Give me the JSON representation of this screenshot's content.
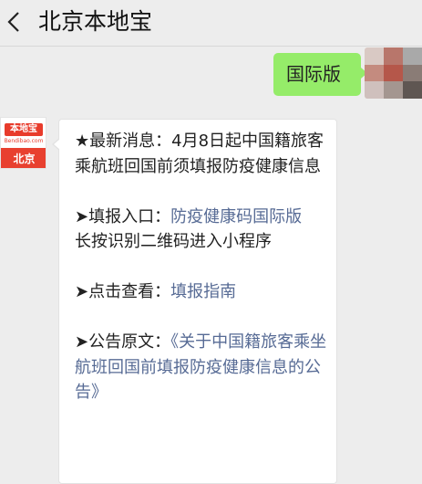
{
  "header": {
    "title": "北京本地宝"
  },
  "my_message": {
    "text": "国际版"
  },
  "avatar_right": {
    "colors": [
      "#d9c9c4",
      "#b8766b",
      "#a9a9a9",
      "#c48b7f",
      "#b5574a",
      "#8a7c76",
      "#cfc0bd",
      "#a49690",
      "#5f5652"
    ]
  },
  "avatar_left": {
    "brand": "本地宝",
    "domain": "Bendibao.com",
    "city": "北京"
  },
  "message": {
    "headline": "★最新消息：4月8日起中国籍旅客乘航班回国前须填报防疫健康信息",
    "entry_prefix": "➤填报入口：",
    "entry_link": "防疫健康码国际版",
    "entry_note": "长按识别二维码进入小程序",
    "view_prefix": "➤点击查看：",
    "view_link": "填报指南",
    "notice_prefix": "➤公告原文：",
    "notice_link": "《关于中国籍旅客乘坐航班回国前填报防疫健康信息的公告》"
  },
  "colors": {
    "bubble_green": "#95ec69",
    "link": "#576b95",
    "brand_red": "#e83b2b"
  }
}
